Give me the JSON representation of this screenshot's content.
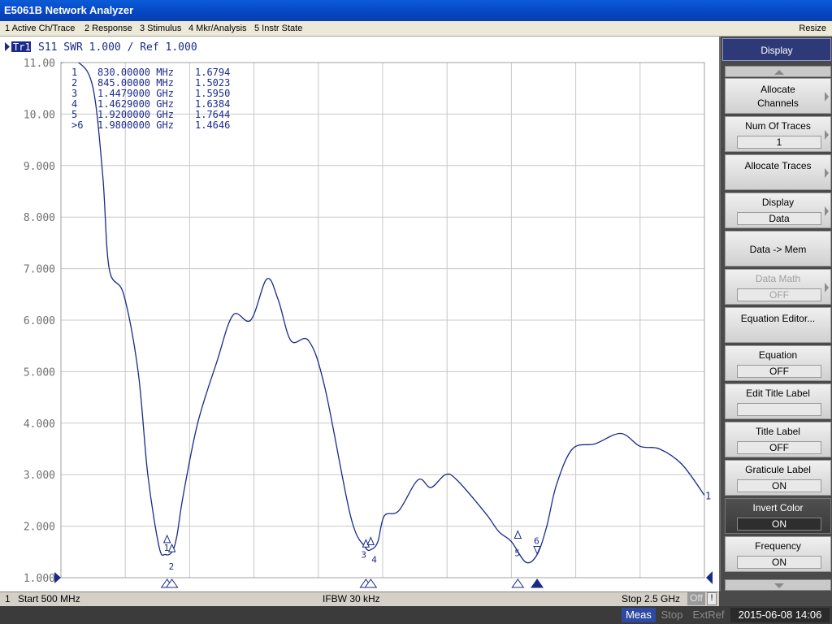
{
  "window": {
    "title": "E5061B Network Analyzer"
  },
  "menu": {
    "items": [
      "1 Active Ch/Trace",
      "2 Response",
      "3 Stimulus",
      "4 Mkr/Analysis",
      "5 Instr State"
    ],
    "resize": "Resize"
  },
  "trace_header": {
    "tag": "Tr1",
    "text": "S11  SWR 1.000 / Ref 1.000"
  },
  "chart_data": {
    "type": "line",
    "xlabel": "",
    "ylabel": "",
    "xlim": [
      500,
      2500
    ],
    "ylim": [
      1.0,
      11.0
    ],
    "x_unit": "MHz",
    "y_ticks": [
      "1.000",
      "2.000",
      "3.000",
      "4.000",
      "5.000",
      "6.000",
      "7.000",
      "8.000",
      "9.000",
      "10.00",
      "11.00"
    ],
    "grid": true,
    "series": [
      {
        "name": "",
        "x": [
          500,
          555,
          600,
          630,
          650,
          695,
          740,
          770,
          805,
          825,
          845,
          860,
          880,
          925,
          985,
          1035,
          1090,
          1140,
          1175,
          1215,
          1270,
          1320,
          1400,
          1445,
          1465,
          1485,
          1505,
          1550,
          1610,
          1650,
          1695,
          1730,
          1820,
          1860,
          1900,
          1945,
          1980,
          2010,
          2040,
          2090,
          2160,
          2240,
          2300,
          2360,
          2430,
          2500
        ],
        "y": [
          11.0,
          11.0,
          10.5,
          8.8,
          7.0,
          6.5,
          5.0,
          3.0,
          1.6,
          1.45,
          1.5,
          1.8,
          2.6,
          4.0,
          5.2,
          6.1,
          6.0,
          6.8,
          6.4,
          5.6,
          5.6,
          4.7,
          2.2,
          1.6,
          1.55,
          1.7,
          2.2,
          2.3,
          2.9,
          2.75,
          3.0,
          2.9,
          2.25,
          1.9,
          1.7,
          1.3,
          1.45,
          2.0,
          2.8,
          3.5,
          3.6,
          3.8,
          3.55,
          3.5,
          3.2,
          2.6
        ]
      }
    ],
    "markers": [
      {
        "label": "1",
        "x": 830.0,
        "y": 1.6794,
        "freq_text": "830.00000 MHz",
        "value_text": "1.6794",
        "active": false
      },
      {
        "label": "2",
        "x": 845.0,
        "y": 1.5023,
        "freq_text": "845.00000 MHz",
        "value_text": "1.5023",
        "active": false
      },
      {
        "label": "3",
        "x": 1447.9,
        "y": 1.595,
        "freq_text": "1.4479000 GHz",
        "value_text": "1.5950",
        "active": false
      },
      {
        "label": "4",
        "x": 1462.9,
        "y": 1.6384,
        "freq_text": "1.4629000 GHz",
        "value_text": "1.6384",
        "active": false
      },
      {
        "label": "5",
        "x": 1920.0,
        "y": 1.7644,
        "freq_text": "1.9200000 GHz",
        "value_text": "1.7644",
        "active": false
      },
      {
        "label": "6",
        "x": 1980.0,
        "y": 1.4646,
        "freq_text": "1.9800000 GHz",
        "value_text": "1.4646",
        "active": true
      }
    ],
    "trace_end_label": "1"
  },
  "status": {
    "channel": "1",
    "start": "Start 500 MHz",
    "ifbw": "IFBW 30 kHz",
    "stop": "Stop 2.5 GHz",
    "off": "Off",
    "excl": "!"
  },
  "softkeys": {
    "header": "Display",
    "buttons": [
      {
        "label": "Allocate Channels",
        "value": null,
        "arrow": true,
        "disabled": false,
        "dark": false
      },
      {
        "label": "Num Of Traces",
        "value": "1",
        "arrow": true,
        "disabled": false,
        "dark": false
      },
      {
        "label": "Allocate Traces",
        "value": null,
        "arrow": true,
        "disabled": false,
        "dark": false
      },
      {
        "label": "Display",
        "value": "Data",
        "arrow": true,
        "disabled": false,
        "dark": false
      },
      {
        "label": "Data -> Mem",
        "value": null,
        "arrow": false,
        "disabled": false,
        "dark": false
      },
      {
        "label": "Data Math",
        "value": "OFF",
        "arrow": true,
        "disabled": true,
        "dark": false
      },
      {
        "label": "Equation Editor...",
        "value": null,
        "arrow": false,
        "disabled": false,
        "dark": false
      },
      {
        "label": "Equation",
        "value": "OFF",
        "arrow": false,
        "disabled": false,
        "dark": false
      },
      {
        "label": "Edit Title Label",
        "value": "",
        "arrow": false,
        "disabled": false,
        "dark": false
      },
      {
        "label": "Title Label",
        "value": "OFF",
        "arrow": false,
        "disabled": false,
        "dark": false
      },
      {
        "label": "Graticule Label",
        "value": "ON",
        "arrow": false,
        "disabled": false,
        "dark": false
      },
      {
        "label": "Invert Color",
        "value": "ON",
        "arrow": false,
        "disabled": false,
        "dark": true
      },
      {
        "label": "Frequency",
        "value": "ON",
        "arrow": false,
        "disabled": false,
        "dark": false
      }
    ]
  },
  "bottom": {
    "meas": "Meas",
    "stop": "Stop",
    "extref": "ExtRef",
    "datetime": "2015-06-08 14:06"
  }
}
